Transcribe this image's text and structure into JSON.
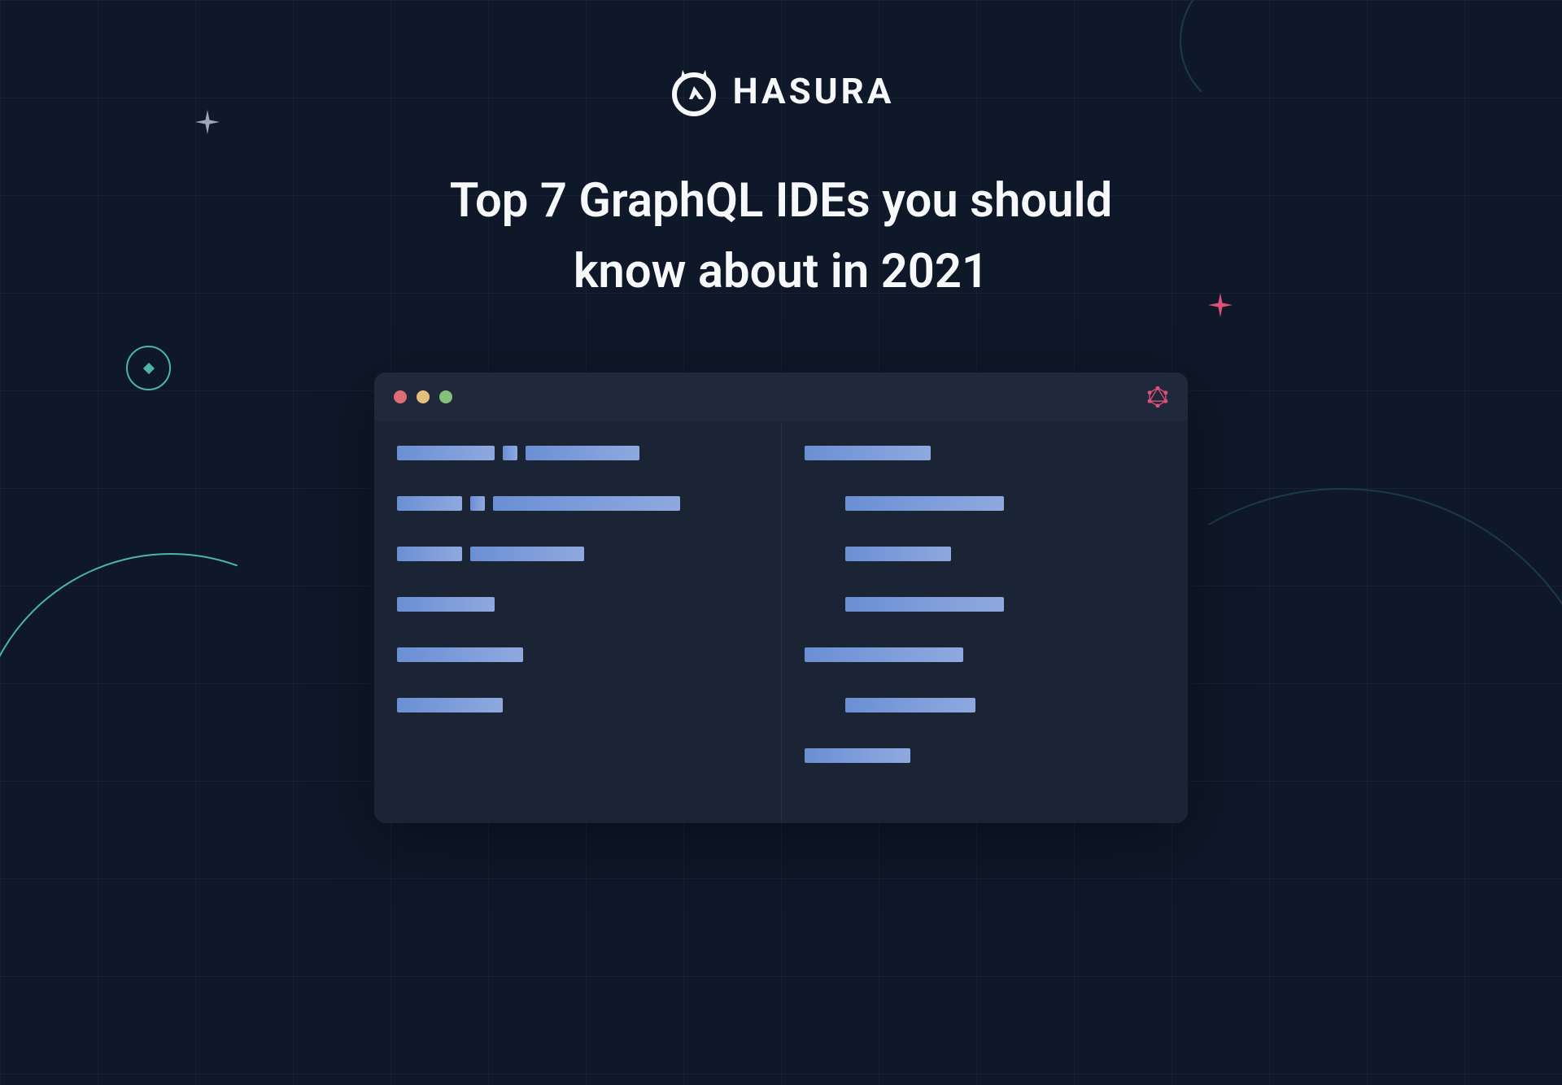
{
  "logo": {
    "text": "HASURA"
  },
  "title": "Top 7 GraphQL IDEs you should know about in 2021",
  "codeWindow": {
    "leftPane": {
      "lines": [
        {
          "indent": 0,
          "bars": [
            120,
            18,
            140
          ]
        },
        {
          "indent": 0,
          "bars": [
            80,
            18,
            230
          ]
        },
        {
          "indent": 0,
          "bars": [
            80,
            140
          ]
        },
        {
          "indent": 0,
          "bars": [
            120
          ]
        },
        {
          "indent": 0,
          "bars": [
            155
          ]
        },
        {
          "indent": 0,
          "bars": [
            130
          ]
        }
      ]
    },
    "rightPane": {
      "lines": [
        {
          "indent": 0,
          "bars": [
            155
          ]
        },
        {
          "indent": 1,
          "bars": [
            195
          ]
        },
        {
          "indent": 1,
          "bars": [
            130
          ]
        },
        {
          "indent": 1,
          "bars": [
            195
          ]
        },
        {
          "indent": 0,
          "bars": [
            195
          ]
        },
        {
          "indent": 1,
          "bars": [
            160
          ]
        },
        {
          "indent": 0,
          "bars": [
            130
          ]
        }
      ]
    }
  }
}
